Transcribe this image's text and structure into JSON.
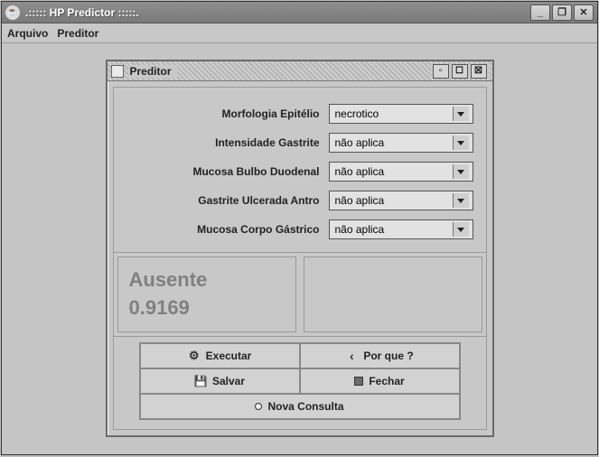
{
  "outer_window": {
    "title": ".::::: HP Predictor :::::.",
    "controls": {
      "min": "_",
      "max": "❐",
      "close": "✕"
    }
  },
  "menubar": {
    "items": [
      "Arquivo",
      "Preditor"
    ]
  },
  "inner_window": {
    "title": "Preditor",
    "controls": {
      "iconify": "▫",
      "max": "☐",
      "close": "☒"
    }
  },
  "fields": [
    {
      "label": "Morfologia Epitélio",
      "value": "necrotico"
    },
    {
      "label": "Intensidade Gastrite",
      "value": "não aplica"
    },
    {
      "label": "Mucosa Bulbo Duodenal",
      "value": "não aplica"
    },
    {
      "label": "Gastrite Ulcerada Antro",
      "value": "não aplica"
    },
    {
      "label": "Mucosa Corpo Gástrico",
      "value": "não aplica"
    }
  ],
  "result": {
    "class": "Ausente",
    "probability": "0.9169"
  },
  "buttons": {
    "executar": "Executar",
    "porque": "Por que ?",
    "salvar": "Salvar",
    "fechar": "Fechar",
    "nova_consulta": "Nova Consulta"
  }
}
